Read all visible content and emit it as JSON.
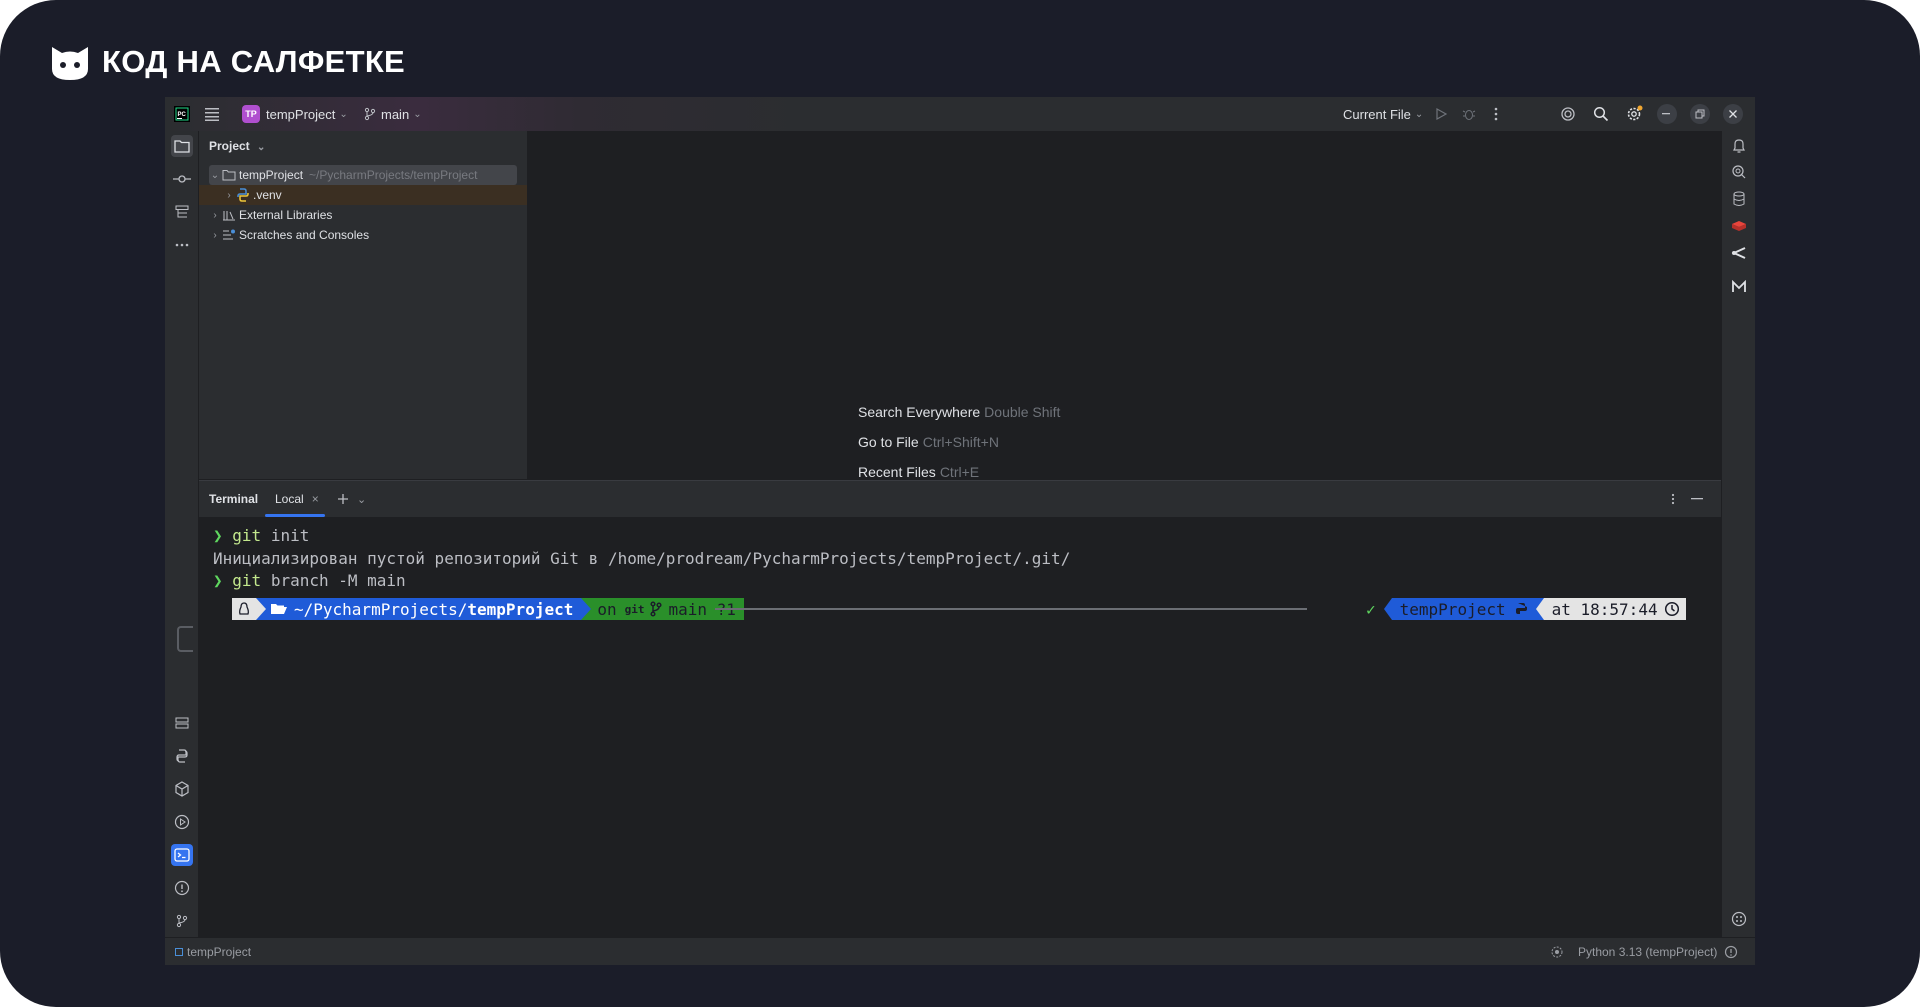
{
  "brand": {
    "text": "КОД НА САЛФЕТКЕ"
  },
  "titlebar": {
    "project_badge": "TP",
    "project_name": "tempProject",
    "branch": "main",
    "run_config": "Current File"
  },
  "project_panel": {
    "title": "Project",
    "tree": [
      {
        "label": "tempProject",
        "path": "~/PycharmProjects/tempProject",
        "expanded": true
      },
      {
        "label": ".venv",
        "path": ""
      },
      {
        "label": "External Libraries",
        "path": ""
      },
      {
        "label": "Scratches and Consoles",
        "path": ""
      }
    ]
  },
  "editor_hints": [
    {
      "label": "Search Everywhere",
      "shortcut": "Double Shift"
    },
    {
      "label": "Go to File",
      "shortcut": "Ctrl+Shift+N"
    },
    {
      "label": "Recent Files",
      "shortcut": "Ctrl+E"
    }
  ],
  "terminal": {
    "title": "Terminal",
    "tab": "Local",
    "lines": [
      {
        "prompt": "❯",
        "cmd": "git",
        "args": " init"
      },
      {
        "text": "Инициализирован пустой репозиторий Git в /home/prodream/PycharmProjects/tempProject/.git/"
      },
      {
        "prompt": "❯",
        "cmd": "git",
        "args": " branch -M main"
      }
    ],
    "prompt_bar": {
      "path_prefix": "~/PycharmProjects/",
      "path_dir": "tempProject",
      "git_on": "on",
      "git_label": "git",
      "branch": "main ?1",
      "check": "✓",
      "venv": "tempProject",
      "time_prefix": "at",
      "time": "18:57:44"
    }
  },
  "statusbar": {
    "project": "tempProject",
    "interpreter": "Python 3.13 (tempProject)"
  },
  "colors": {
    "accent": "#3574f0",
    "git_green": "#2a8f2a",
    "path_blue": "#1f5bd8"
  }
}
